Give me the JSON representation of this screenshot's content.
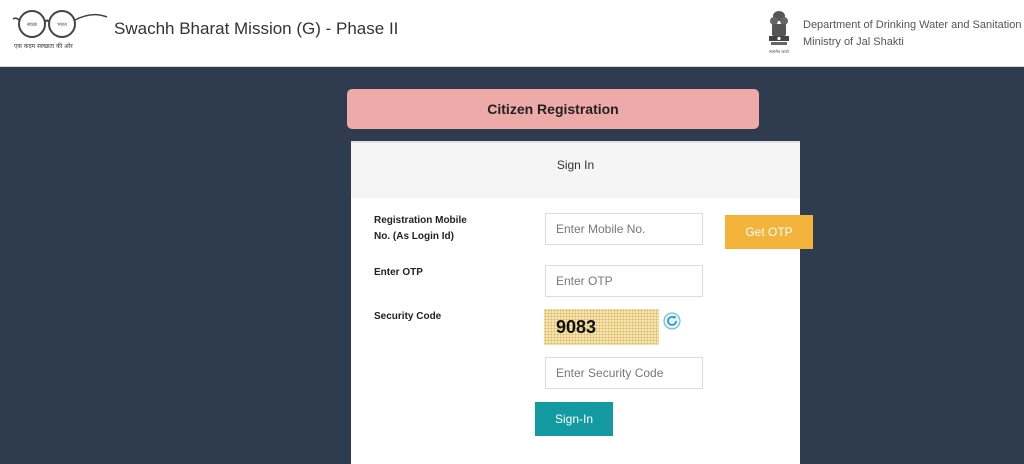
{
  "header": {
    "logo_tagline": "एक कदम स्वच्छता की ओर",
    "title": "Swachh Bharat Mission (G) - Phase II",
    "department": "Department of Drinking Water and Sanitation",
    "ministry": "Ministry of Jal Shakti"
  },
  "banner": {
    "label": "Citizen Registration"
  },
  "form": {
    "heading": "Sign In",
    "mobile": {
      "label_line1": "Registration Mobile",
      "label_line2": "No. (As Login Id)",
      "placeholder": "Enter Mobile No.",
      "value": ""
    },
    "get_otp_label": "Get OTP",
    "otp": {
      "label": "Enter OTP",
      "placeholder": "Enter OTP",
      "value": ""
    },
    "security": {
      "label": "Security Code",
      "captcha": "9083",
      "placeholder": "Enter Security Code",
      "value": ""
    },
    "signin_label": "Sign-In"
  },
  "colors": {
    "page_background": "#2f3b4e",
    "banner": "#eea9a9",
    "otp_button": "#f4b43c",
    "signin_button": "#139aa0",
    "captcha_background": "#f7e7b2"
  },
  "icons": {
    "logo": "gandhi-spectacles-icon",
    "emblem": "national-emblem-icon",
    "refresh": "refresh-icon"
  }
}
